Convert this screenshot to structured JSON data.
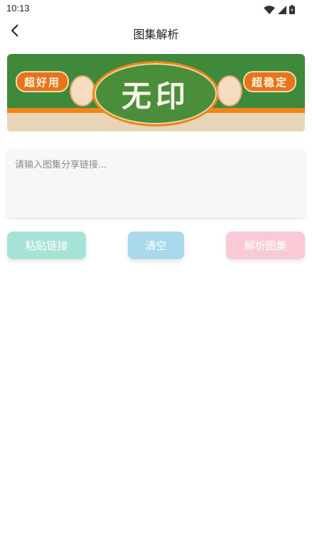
{
  "status_bar": {
    "time": "10:13",
    "icons": [
      "wifi-icon",
      "signal-icon",
      "battery-icon"
    ]
  },
  "header": {
    "title": "图集解析",
    "back_icon": "chevron-left-icon"
  },
  "banner": {
    "badge_left": "超好用",
    "badge_right": "超稳定",
    "center_text": "无印"
  },
  "input": {
    "placeholder": "请输入图集分享链接...",
    "value": ""
  },
  "buttons": {
    "paste_label": "粘贴链接",
    "clear_label": "清空",
    "parse_label": "解析图集"
  },
  "colors": {
    "paste": "#a6e3d7",
    "clear": "#a9d9ea",
    "parse": "#f9cad6",
    "banner_green": "#3e8a3a",
    "banner_orange": "#f08418"
  }
}
